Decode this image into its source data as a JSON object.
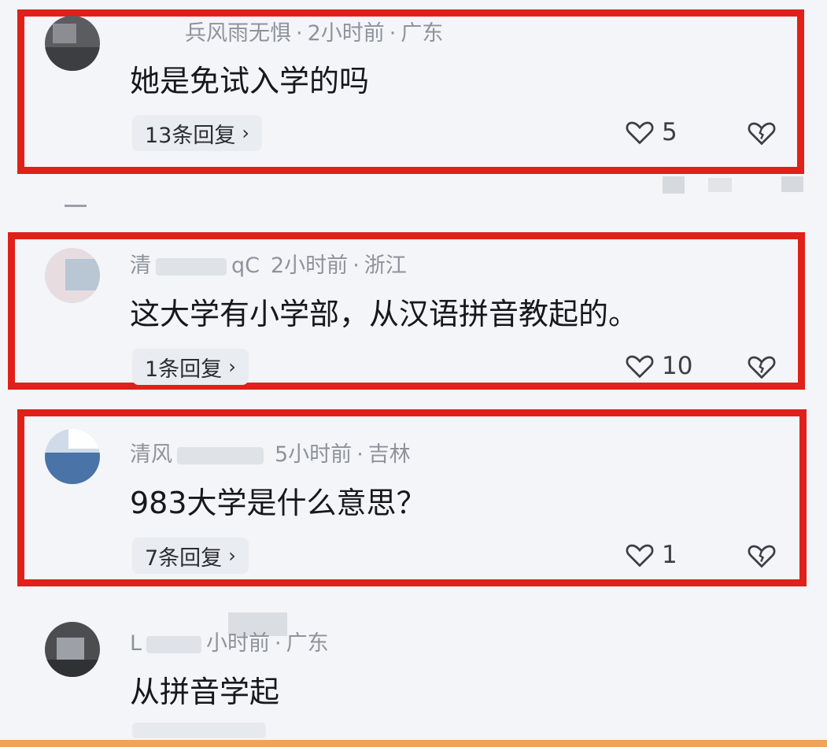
{
  "comments": [
    {
      "user": "兵风雨无惧",
      "time": "2小时前",
      "location": "广东",
      "text": "她是免试入学的吗",
      "replies": "13条回复",
      "likes": "5",
      "highlighted": true
    },
    {
      "user": "清",
      "user_suffix": "qC",
      "time": "2小时前",
      "location": "浙江",
      "text": "这大学有小学部，从汉语拼音教起的。",
      "replies": "1条回复",
      "likes": "10",
      "highlighted": true
    },
    {
      "user": "清风",
      "time": "5小时前",
      "location": "吉林",
      "text": "983大学是什么意思？",
      "replies": "7条回复",
      "likes": "1",
      "highlighted": true
    },
    {
      "user": "L",
      "time": "小时前",
      "location": "广东",
      "text": "从拼音学起",
      "highlighted": false
    }
  ],
  "separator": "·",
  "colors": {
    "highlight_border": "#e0201a",
    "background": "#f3f5f8"
  },
  "icons": {
    "like": "heart-outline-icon",
    "dislike": "broken-heart-icon",
    "reply_chevron": "chevron-right-icon"
  }
}
